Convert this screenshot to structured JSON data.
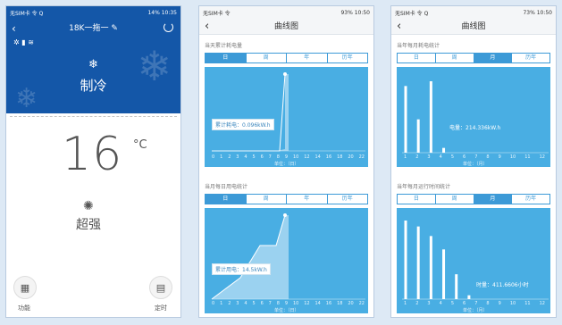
{
  "phone1": {
    "status_left": "无SIM卡 令 Q",
    "status_right": "14%  10:35",
    "title": "18K一拖一",
    "mode_label": "制冷",
    "temperature": "16",
    "unit": "°C",
    "fan_label": "超强",
    "function_label": "功能",
    "timer_label": "定时"
  },
  "phone2": {
    "status_left": "无SIM卡 令",
    "status_right": "93%  10:50",
    "nav_title": "曲线图",
    "section1_title": "当天累计耗电量",
    "section1_tabs": [
      "日",
      "周",
      "年",
      "历年"
    ],
    "section1_annotation": "累计耗电：0.096kW.h",
    "section2_title": "当月每日用电统计",
    "section2_tabs": [
      "日",
      "周",
      "年",
      "历年"
    ],
    "section2_annotation": "累计用电：14.5kW.h",
    "x_ticks": [
      "0",
      "1",
      "2",
      "3",
      "4",
      "5",
      "6",
      "7",
      "8",
      "9",
      "10",
      "12",
      "14",
      "16",
      "18",
      "20",
      "22"
    ],
    "x_unit": "单位：（日）"
  },
  "phone3": {
    "status_left": "无SIM卡 令 Q",
    "status_right": "73%  10:50",
    "nav_title": "曲线图",
    "section1_title": "当年每月耗电统计",
    "section1_tabs": [
      "日",
      "周",
      "月",
      "历年"
    ],
    "section1_annotation": "电量：214.336kW.h",
    "section1_unit": "单位：（月）",
    "section2_title": "当年每月运行时间统计",
    "section2_tabs": [
      "日",
      "周",
      "月",
      "历年"
    ],
    "section2_annotation": "时量：411.6606小时",
    "section2_unit": "单位：（月）",
    "x_ticks": [
      "1",
      "2",
      "3",
      "4",
      "5",
      "6",
      "7",
      "8",
      "9",
      "10",
      "11",
      "12"
    ]
  },
  "colors": {
    "header_blue": "#1457a8",
    "chart_blue": "#49aee3",
    "tab_blue": "#3c9ad7"
  },
  "chart_data": [
    {
      "type": "area",
      "title": "当天累计耗电量",
      "x": [
        0,
        2,
        4,
        6,
        8,
        9,
        10
      ],
      "values": [
        0,
        0,
        0,
        0,
        0,
        0.096,
        0.096
      ]
    },
    {
      "type": "area",
      "title": "当月每日用电统计",
      "x": [
        0,
        2,
        4,
        5,
        6,
        7,
        8,
        10
      ],
      "values": [
        0,
        3,
        7,
        10,
        10,
        14.5,
        14.5,
        14.5
      ]
    },
    {
      "type": "bar",
      "title": "当年每月耗电统计",
      "categories": [
        "1",
        "2",
        "3",
        "4",
        "5",
        "6",
        "7",
        "8",
        "9",
        "10",
        "11",
        "12"
      ],
      "values": [
        140,
        70,
        150,
        10,
        0,
        0,
        0,
        0,
        0,
        0,
        0,
        0
      ]
    },
    {
      "type": "bar",
      "title": "当年每月运行时间统计",
      "categories": [
        "1",
        "2",
        "3",
        "4",
        "5",
        "6",
        "7",
        "8",
        "9",
        "10",
        "11",
        "12"
      ],
      "values": [
        411,
        380,
        330,
        260,
        130,
        20,
        0,
        0,
        0,
        0,
        0,
        0
      ]
    }
  ]
}
